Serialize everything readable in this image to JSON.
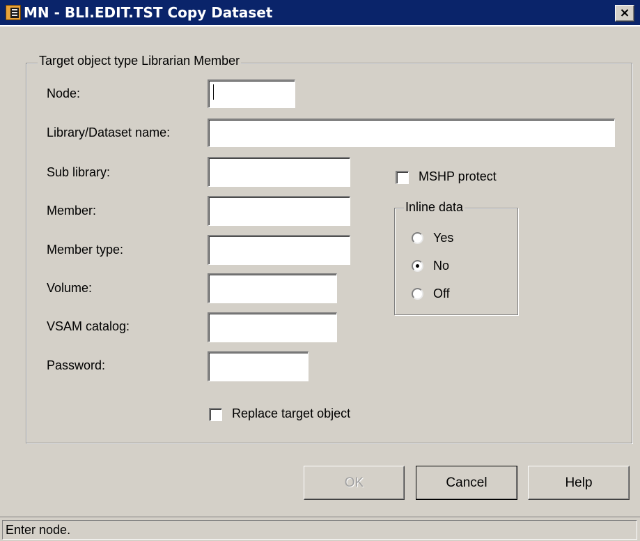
{
  "window": {
    "title": "MN - BLI.EDIT.TST Copy Dataset",
    "close_glyph": "×"
  },
  "group": {
    "legend": "Target object type Librarian Member"
  },
  "fields": {
    "node_label": "Node:",
    "library_label": "Library/Dataset name:",
    "sublibrary_label": "Sub library:",
    "member_label": "Member:",
    "membertype_label": "Member type:",
    "volume_label": "Volume:",
    "vsam_label": "VSAM catalog:",
    "password_label": "Password:"
  },
  "options": {
    "mshp_label": "MSHP protect",
    "mshp_checked": false,
    "inline_legend": "Inline data",
    "inline_options": [
      "Yes",
      "No",
      "Off"
    ],
    "inline_selected": "No",
    "replace_label": "Replace target object",
    "replace_checked": false
  },
  "buttons": {
    "ok": "OK",
    "cancel": "Cancel",
    "help": "Help"
  },
  "status": {
    "text": "Enter node."
  },
  "icons": {
    "app": "librarian-app-icon",
    "close": "close-icon"
  },
  "colors": {
    "titlebar": "#0a246a",
    "dialog_bg": "#d4d0c8"
  }
}
